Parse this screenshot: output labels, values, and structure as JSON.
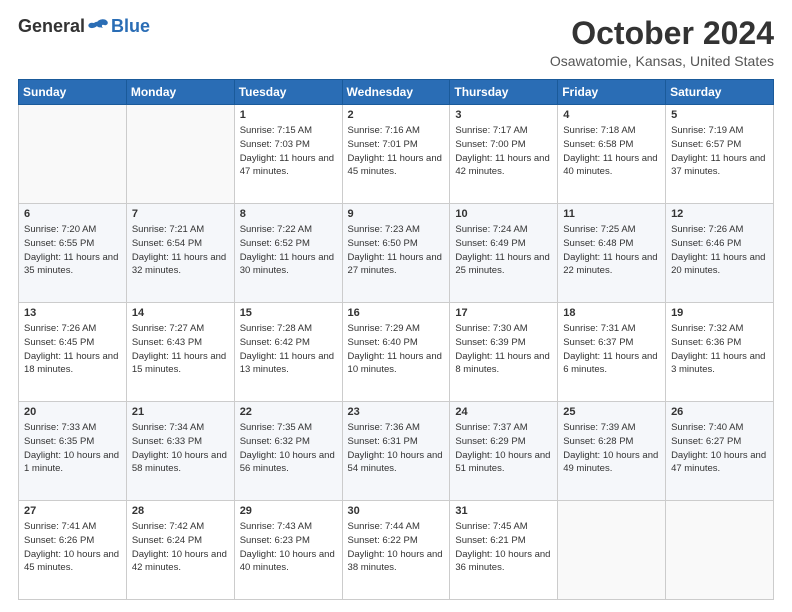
{
  "logo": {
    "general": "General",
    "blue": "Blue"
  },
  "header": {
    "month": "October 2024",
    "location": "Osawatomie, Kansas, United States"
  },
  "weekdays": [
    "Sunday",
    "Monday",
    "Tuesday",
    "Wednesday",
    "Thursday",
    "Friday",
    "Saturday"
  ],
  "weeks": [
    [
      {
        "day": "",
        "empty": true
      },
      {
        "day": "",
        "empty": true
      },
      {
        "day": "1",
        "sunrise": "7:15 AM",
        "sunset": "7:03 PM",
        "daylight": "11 hours and 47 minutes."
      },
      {
        "day": "2",
        "sunrise": "7:16 AM",
        "sunset": "7:01 PM",
        "daylight": "11 hours and 45 minutes."
      },
      {
        "day": "3",
        "sunrise": "7:17 AM",
        "sunset": "7:00 PM",
        "daylight": "11 hours and 42 minutes."
      },
      {
        "day": "4",
        "sunrise": "7:18 AM",
        "sunset": "6:58 PM",
        "daylight": "11 hours and 40 minutes."
      },
      {
        "day": "5",
        "sunrise": "7:19 AM",
        "sunset": "6:57 PM",
        "daylight": "11 hours and 37 minutes."
      }
    ],
    [
      {
        "day": "6",
        "sunrise": "7:20 AM",
        "sunset": "6:55 PM",
        "daylight": "11 hours and 35 minutes."
      },
      {
        "day": "7",
        "sunrise": "7:21 AM",
        "sunset": "6:54 PM",
        "daylight": "11 hours and 32 minutes."
      },
      {
        "day": "8",
        "sunrise": "7:22 AM",
        "sunset": "6:52 PM",
        "daylight": "11 hours and 30 minutes."
      },
      {
        "day": "9",
        "sunrise": "7:23 AM",
        "sunset": "6:50 PM",
        "daylight": "11 hours and 27 minutes."
      },
      {
        "day": "10",
        "sunrise": "7:24 AM",
        "sunset": "6:49 PM",
        "daylight": "11 hours and 25 minutes."
      },
      {
        "day": "11",
        "sunrise": "7:25 AM",
        "sunset": "6:48 PM",
        "daylight": "11 hours and 22 minutes."
      },
      {
        "day": "12",
        "sunrise": "7:26 AM",
        "sunset": "6:46 PM",
        "daylight": "11 hours and 20 minutes."
      }
    ],
    [
      {
        "day": "13",
        "sunrise": "7:26 AM",
        "sunset": "6:45 PM",
        "daylight": "11 hours and 18 minutes."
      },
      {
        "day": "14",
        "sunrise": "7:27 AM",
        "sunset": "6:43 PM",
        "daylight": "11 hours and 15 minutes."
      },
      {
        "day": "15",
        "sunrise": "7:28 AM",
        "sunset": "6:42 PM",
        "daylight": "11 hours and 13 minutes."
      },
      {
        "day": "16",
        "sunrise": "7:29 AM",
        "sunset": "6:40 PM",
        "daylight": "11 hours and 10 minutes."
      },
      {
        "day": "17",
        "sunrise": "7:30 AM",
        "sunset": "6:39 PM",
        "daylight": "11 hours and 8 minutes."
      },
      {
        "day": "18",
        "sunrise": "7:31 AM",
        "sunset": "6:37 PM",
        "daylight": "11 hours and 6 minutes."
      },
      {
        "day": "19",
        "sunrise": "7:32 AM",
        "sunset": "6:36 PM",
        "daylight": "11 hours and 3 minutes."
      }
    ],
    [
      {
        "day": "20",
        "sunrise": "7:33 AM",
        "sunset": "6:35 PM",
        "daylight": "10 hours and 1 minute."
      },
      {
        "day": "21",
        "sunrise": "7:34 AM",
        "sunset": "6:33 PM",
        "daylight": "10 hours and 58 minutes."
      },
      {
        "day": "22",
        "sunrise": "7:35 AM",
        "sunset": "6:32 PM",
        "daylight": "10 hours and 56 minutes."
      },
      {
        "day": "23",
        "sunrise": "7:36 AM",
        "sunset": "6:31 PM",
        "daylight": "10 hours and 54 minutes."
      },
      {
        "day": "24",
        "sunrise": "7:37 AM",
        "sunset": "6:29 PM",
        "daylight": "10 hours and 51 minutes."
      },
      {
        "day": "25",
        "sunrise": "7:39 AM",
        "sunset": "6:28 PM",
        "daylight": "10 hours and 49 minutes."
      },
      {
        "day": "26",
        "sunrise": "7:40 AM",
        "sunset": "6:27 PM",
        "daylight": "10 hours and 47 minutes."
      }
    ],
    [
      {
        "day": "27",
        "sunrise": "7:41 AM",
        "sunset": "6:26 PM",
        "daylight": "10 hours and 45 minutes."
      },
      {
        "day": "28",
        "sunrise": "7:42 AM",
        "sunset": "6:24 PM",
        "daylight": "10 hours and 42 minutes."
      },
      {
        "day": "29",
        "sunrise": "7:43 AM",
        "sunset": "6:23 PM",
        "daylight": "10 hours and 40 minutes."
      },
      {
        "day": "30",
        "sunrise": "7:44 AM",
        "sunset": "6:22 PM",
        "daylight": "10 hours and 38 minutes."
      },
      {
        "day": "31",
        "sunrise": "7:45 AM",
        "sunset": "6:21 PM",
        "daylight": "10 hours and 36 minutes."
      },
      {
        "day": "",
        "empty": true
      },
      {
        "day": "",
        "empty": true
      }
    ]
  ]
}
